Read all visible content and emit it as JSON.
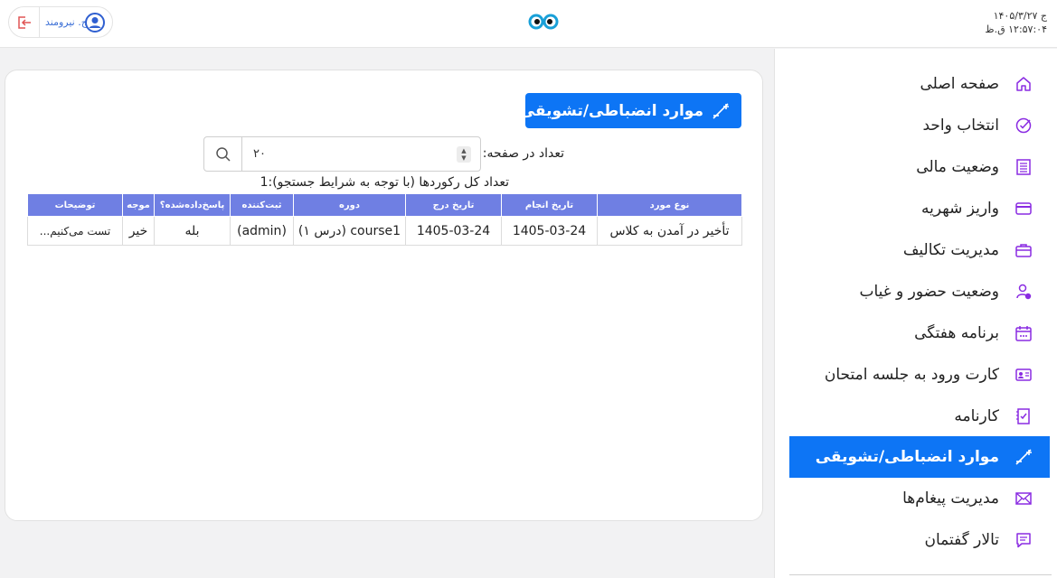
{
  "header": {
    "date": "ج ۱۴۰۵/۳/۲۷",
    "time": "۱۲:۵۷:۰۴ ق.ظ",
    "user_name": "ج. نیرومند",
    "logo": "owl-logo-icon"
  },
  "sidebar": {
    "items": [
      {
        "label": "صفحه اصلی",
        "icon": "home-icon"
      },
      {
        "label": "انتخاب واحد",
        "icon": "check-circle-icon"
      },
      {
        "label": "وضعیت مالی",
        "icon": "receipt-icon"
      },
      {
        "label": "واریز شهریه",
        "icon": "credit-card-icon"
      },
      {
        "label": "مدیریت تکالیف",
        "icon": "briefcase-icon"
      },
      {
        "label": "وضعیت حضور و غیاب",
        "icon": "user-check-icon"
      },
      {
        "label": "برنامه هفتگی",
        "icon": "calendar-icon"
      },
      {
        "label": "کارت ورود به جلسه امتحان",
        "icon": "id-card-icon"
      },
      {
        "label": "کارنامه",
        "icon": "report-card-icon"
      },
      {
        "label": "موارد انضباطی/تشویقی",
        "icon": "plus-minus-icon"
      },
      {
        "label": "مدیریت پیغام‌ها",
        "icon": "envelope-icon"
      },
      {
        "label": "تالار گفتمان",
        "icon": "chat-icon"
      }
    ],
    "active_index": 9
  },
  "main": {
    "title": "موارد انضباطی/تشویقی",
    "per_page_label": "تعداد در صفحه:",
    "per_page_value": "۲۰",
    "total_label": "تعداد کل رکوردها (با توجه به شرایط جستجو):1",
    "table": {
      "columns": [
        "نوع مورد",
        "تاریخ انجام",
        "تاریخ درج",
        "دوره",
        "ثبت‌کننده",
        "پاسخ‌داده‌شده؟",
        "موجه",
        "توضیحات"
      ],
      "rows": [
        [
          "تأخیر در آمدن به کلاس",
          "1405-03-24",
          "1405-03-24",
          "course1 (درس ۱)",
          "(admin)",
          "بله",
          "خیر",
          "تست می‌کنیم..."
        ]
      ]
    }
  },
  "colors": {
    "accent": "#0d75f5",
    "table_header": "#6f7fe3",
    "icon_purple": "#8a2be2"
  }
}
